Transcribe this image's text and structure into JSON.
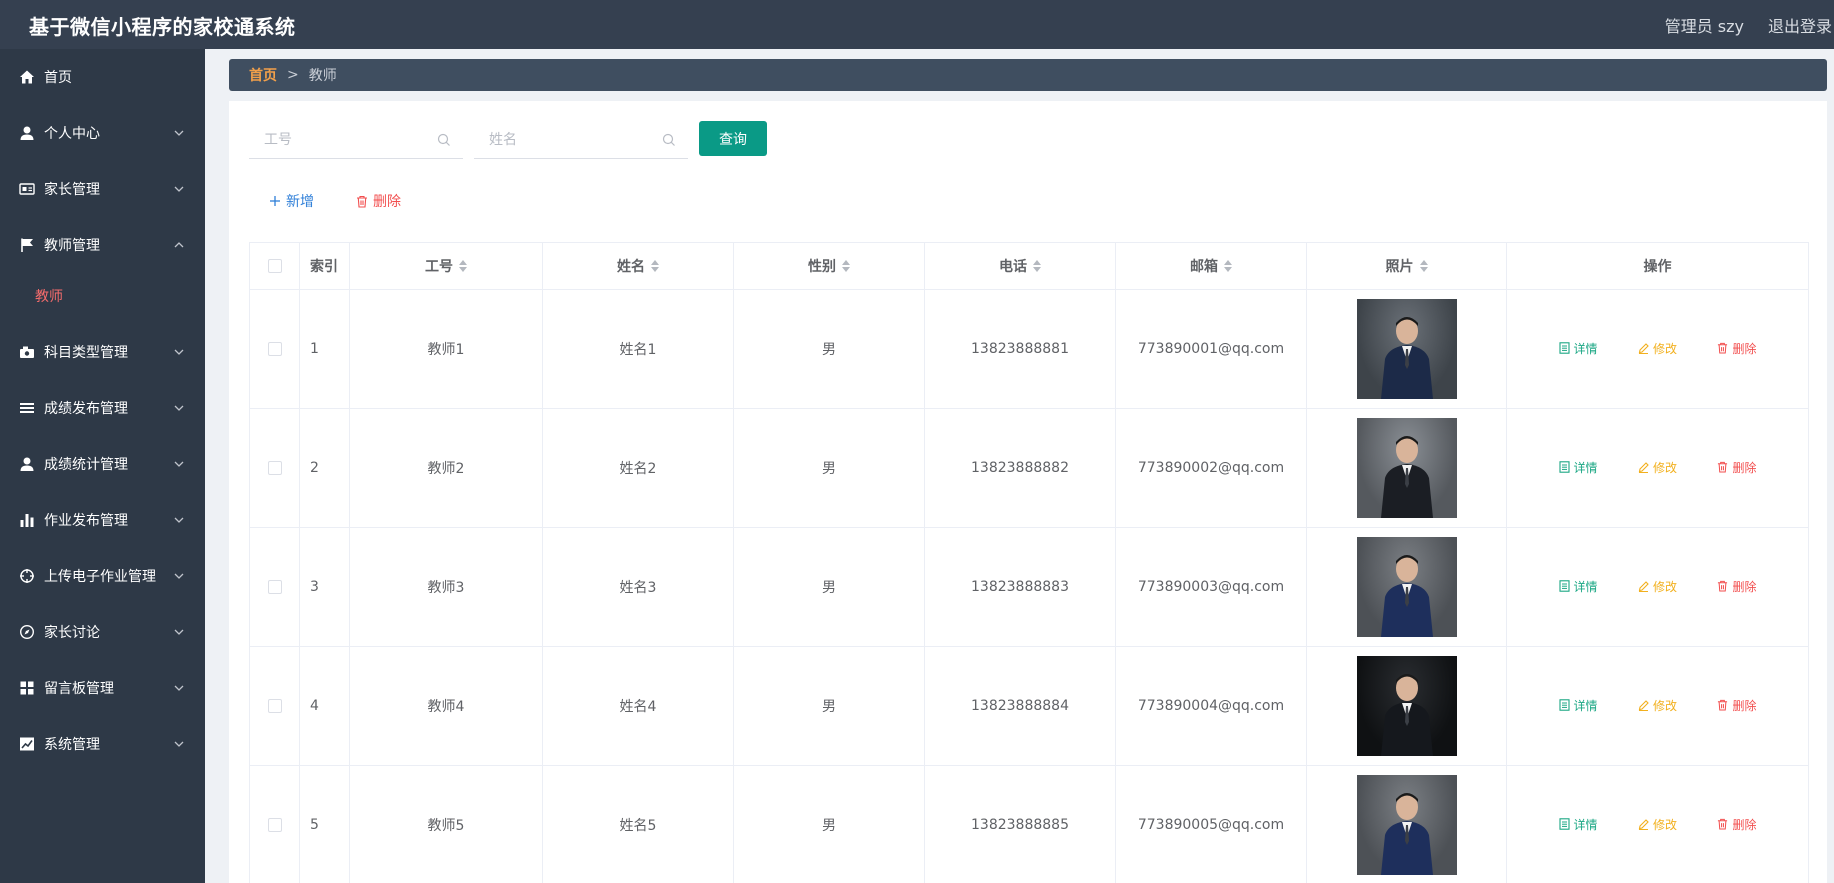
{
  "app": {
    "title": "基于微信小程序的家校通系统",
    "admin_label": "管理员 szy",
    "logout": "退出登录"
  },
  "sidebar": {
    "items": [
      {
        "label": "首页",
        "icon": "home-icon"
      },
      {
        "label": "个人中心",
        "icon": "user-icon"
      },
      {
        "label": "家长管理",
        "icon": "id-card-icon"
      },
      {
        "label": "教师管理",
        "icon": "flag-icon"
      },
      {
        "label": "科目类型管理",
        "icon": "camera-icon"
      },
      {
        "label": "成绩发布管理",
        "icon": "list-icon"
      },
      {
        "label": "成绩统计管理",
        "icon": "user-icon"
      },
      {
        "label": "作业发布管理",
        "icon": "bar-chart-icon"
      },
      {
        "label": "上传电子作业管理",
        "icon": "crosshair-icon"
      },
      {
        "label": "家长讨论",
        "icon": "compass-icon"
      },
      {
        "label": "留言板管理",
        "icon": "grid-icon"
      },
      {
        "label": "系统管理",
        "icon": "trend-chart-icon"
      }
    ],
    "active_sub": "教师"
  },
  "breadcrumb": {
    "home": "首页",
    "separator": ">",
    "current": "教师"
  },
  "search": {
    "id_placeholder": "工号",
    "name_placeholder": "姓名",
    "query_button": "查询"
  },
  "actions": {
    "add": "新增",
    "delete": "删除"
  },
  "table": {
    "headers": {
      "index": "索引",
      "id": "工号",
      "name": "姓名",
      "gender": "性别",
      "phone": "电话",
      "email": "邮箱",
      "photo": "照片",
      "ops": "操作"
    },
    "op_labels": {
      "detail": "详情",
      "edit": "修改",
      "delete": "删除"
    },
    "rows": [
      {
        "index": "1",
        "id": "教师1",
        "name": "姓名1",
        "gender": "男",
        "phone": "13823888881",
        "email": "773890001@qq.com"
      },
      {
        "index": "2",
        "id": "教师2",
        "name": "姓名2",
        "gender": "男",
        "phone": "13823888882",
        "email": "773890002@qq.com"
      },
      {
        "index": "3",
        "id": "教师3",
        "name": "姓名3",
        "gender": "男",
        "phone": "13823888883",
        "email": "773890003@qq.com"
      },
      {
        "index": "4",
        "id": "教师4",
        "name": "姓名4",
        "gender": "男",
        "phone": "13823888884",
        "email": "773890004@qq.com"
      },
      {
        "index": "5",
        "id": "教师5",
        "name": "姓名5",
        "gender": "男",
        "phone": "13823888885",
        "email": "773890005@qq.com"
      }
    ]
  },
  "colors": {
    "topbar": "#354050",
    "sidebar": "#2e3947",
    "accent": "#0a9a86",
    "active_sub": "#f56c6c",
    "breadcrumb_home": "#f2a04a"
  }
}
